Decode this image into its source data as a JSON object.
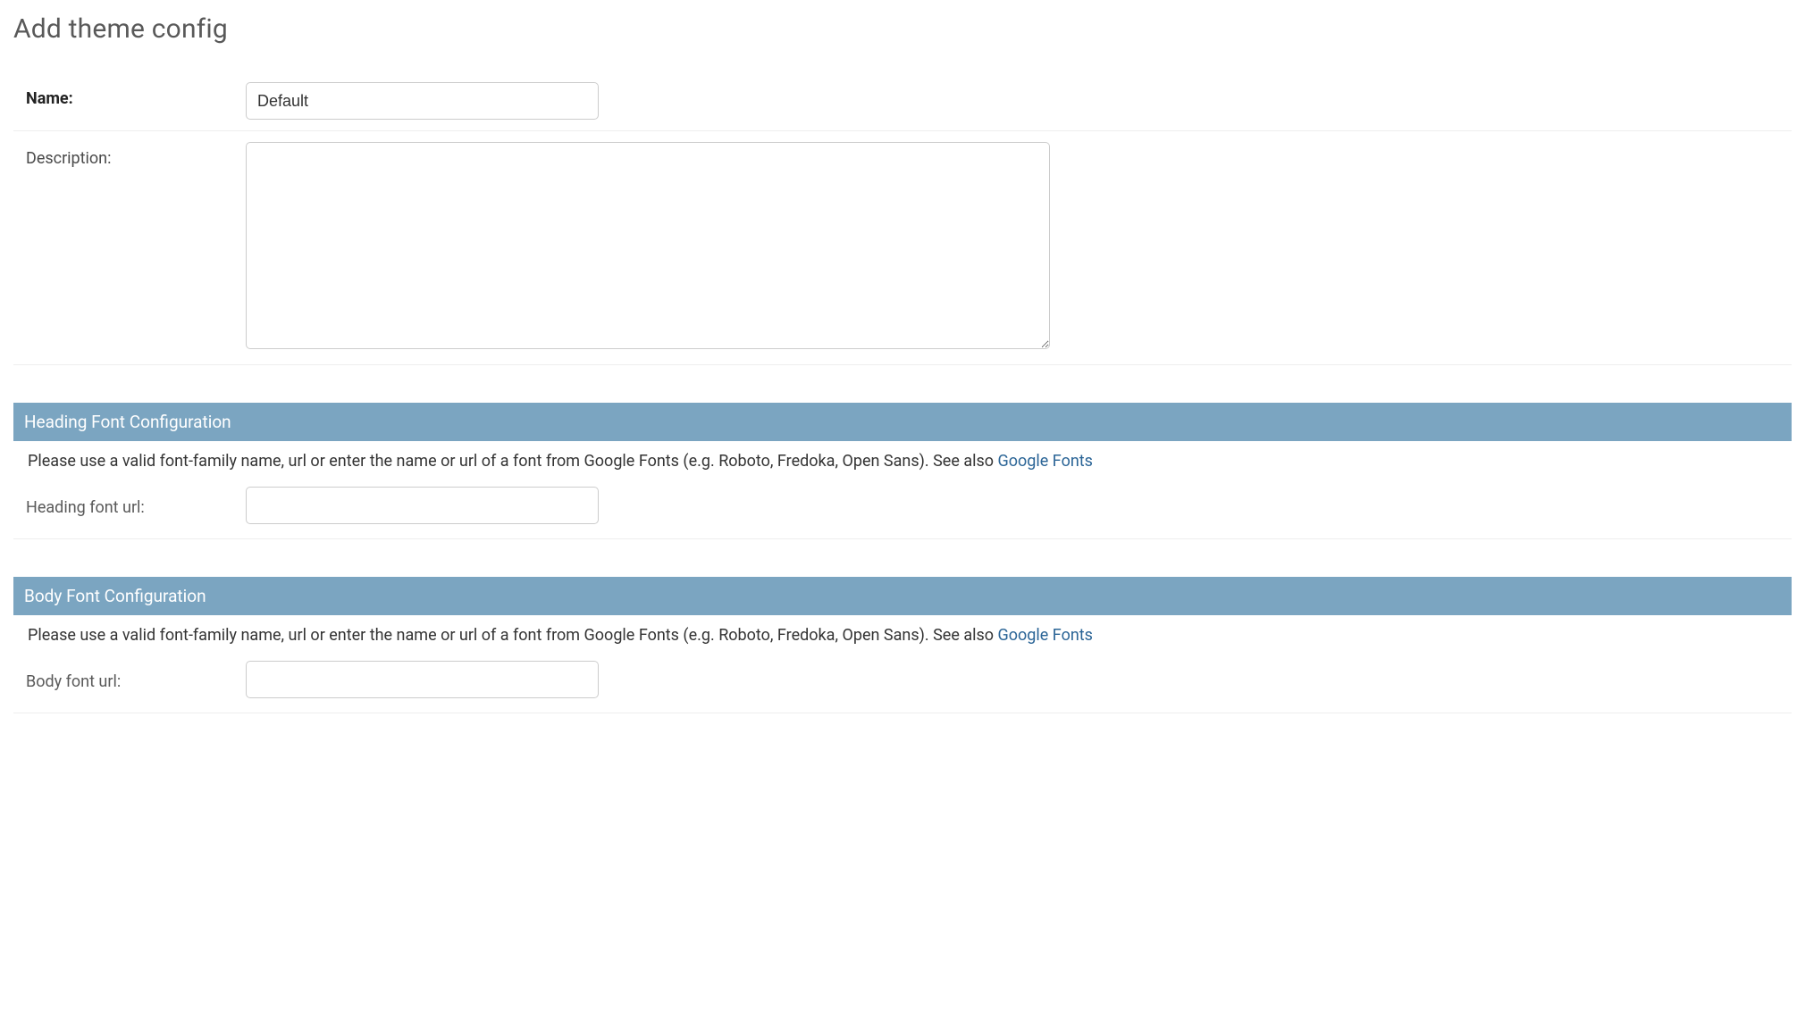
{
  "page": {
    "title": "Add theme config"
  },
  "fields": {
    "name": {
      "label": "Name:",
      "value": "Default"
    },
    "description": {
      "label": "Description:",
      "value": ""
    }
  },
  "sections": {
    "heading_font": {
      "title": "Heading Font Configuration",
      "help_text": "Please use a valid font-family name, url or enter the name or url of a font from Google Fonts (e.g. Roboto, Fredoka, Open Sans). See also ",
      "help_link_text": "Google Fonts",
      "field_label": "Heading font url:",
      "field_value": ""
    },
    "body_font": {
      "title": "Body Font Configuration",
      "help_text": "Please use a valid font-family name, url or enter the name or url of a font from Google Fonts (e.g. Roboto, Fredoka, Open Sans). See also ",
      "help_link_text": "Google Fonts",
      "field_label": "Body font url:",
      "field_value": ""
    }
  }
}
